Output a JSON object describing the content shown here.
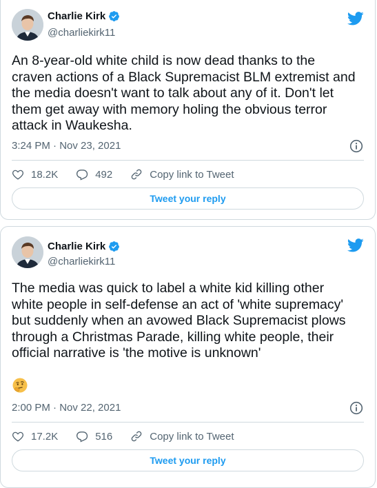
{
  "colors": {
    "accent": "#1d9bf0",
    "text": "#0f1419",
    "muted": "#536471",
    "border": "#cfd9de"
  },
  "tweets": [
    {
      "author": {
        "name": "Charlie Kirk",
        "handle": "@charliekirk11",
        "verified": true
      },
      "text": "An 8-year-old white child is now dead thanks to the\ncraven actions of a Black Supremacist BLM extremist and\nthe media doesn't want to talk about any of it. Don't let\nthem get away with memory holing the obvious terror\nattack in Waukesha.",
      "has_emoji": false,
      "timestamp": "3:24 PM · Nov 23, 2021",
      "likes": "18.2K",
      "replies": "492",
      "copy_link_label": "Copy link to Tweet",
      "reply_button_label": "Tweet your reply",
      "icons": [
        "heart-icon",
        "reply-icon",
        "link-icon",
        "info-icon",
        "twitter-bird-icon"
      ]
    },
    {
      "author": {
        "name": "Charlie Kirk",
        "handle": "@charliekirk11",
        "verified": true
      },
      "text": "The media was quick to label a white kid killing other\nwhite people in self-defense an act of 'white supremacy'\nbut suddenly when an avowed Black Supremacist plows\nthrough a Christmas Parade, killing white people, their\nofficial narrative is 'the motive is unknown'",
      "has_emoji": true,
      "emoji": "thinking-face-emoji",
      "timestamp": "2:00 PM · Nov 22, 2021",
      "likes": "17.2K",
      "replies": "516",
      "copy_link_label": "Copy link to Tweet",
      "reply_button_label": "Tweet your reply",
      "icons": [
        "heart-icon",
        "reply-icon",
        "link-icon",
        "info-icon",
        "twitter-bird-icon"
      ]
    }
  ]
}
